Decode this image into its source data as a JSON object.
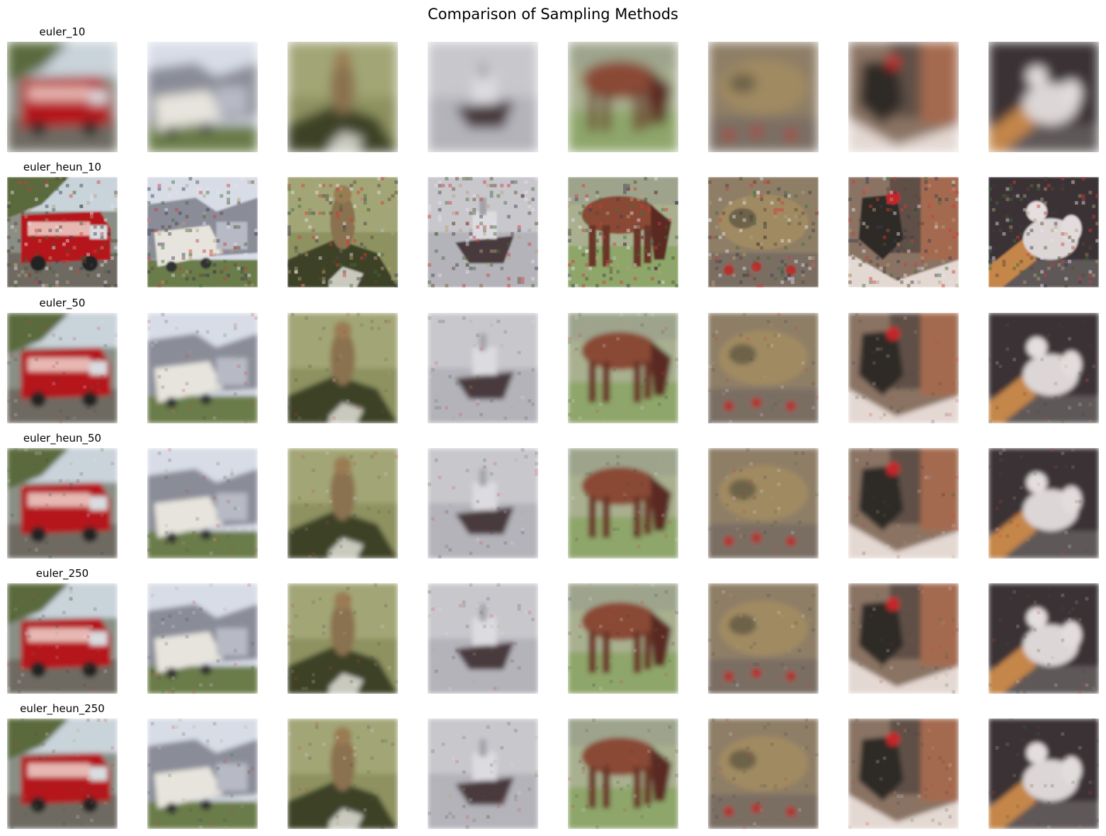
{
  "figure": {
    "title": "Comparison of Sampling Methods"
  },
  "rows": [
    {
      "label": "euler_10",
      "style": "smooth"
    },
    {
      "label": "euler_heun_10",
      "style": "noisy"
    },
    {
      "label": "euler_50",
      "style": "medium"
    },
    {
      "label": "euler_heun_50",
      "style": "medium"
    },
    {
      "label": "euler_250",
      "style": "medium"
    },
    {
      "label": "euler_heun_250",
      "style": "medium"
    }
  ],
  "columns": [
    {
      "subject": "fire-truck"
    },
    {
      "subject": "truck-building"
    },
    {
      "subject": "bird-on-rock"
    },
    {
      "subject": "boat"
    },
    {
      "subject": "horse"
    },
    {
      "subject": "frog"
    },
    {
      "subject": "cat-on-shelf"
    },
    {
      "subject": "dog"
    }
  ]
}
